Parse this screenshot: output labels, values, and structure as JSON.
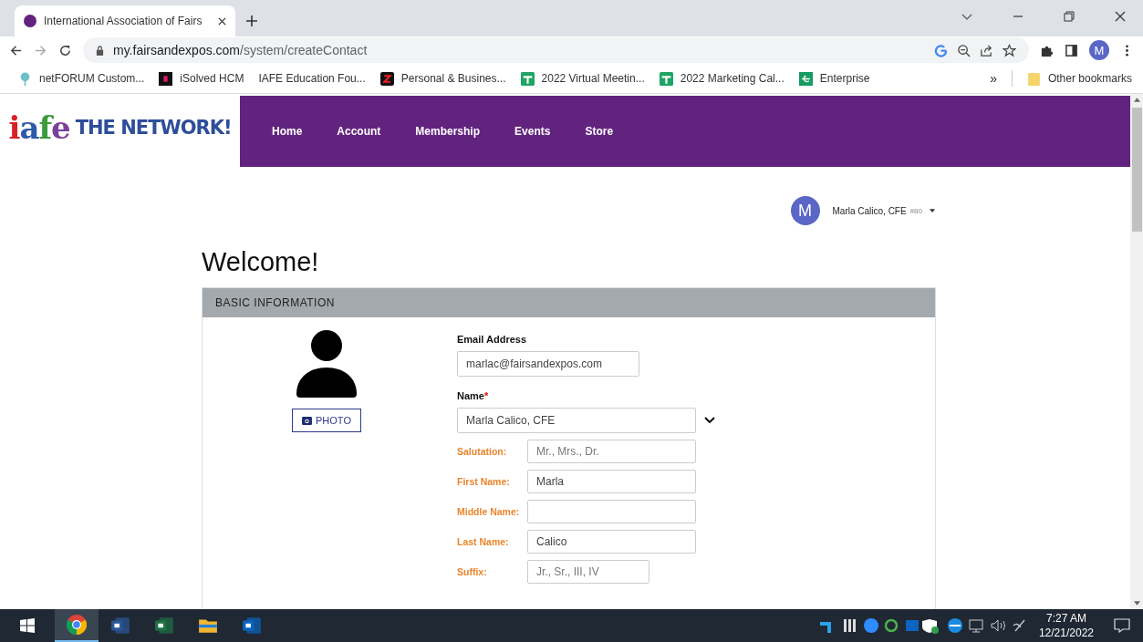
{
  "browser": {
    "tab": {
      "title": "International Association of Fairs",
      "selected": true
    },
    "address": {
      "domain": "my.fairsandexpos.com",
      "path": "/system/createContact"
    },
    "profile": "M",
    "bookmarks": [
      {
        "kind": "tree",
        "label": "netFORUM Custom..."
      },
      {
        "kind": "isolved",
        "label": "iSolved HCM"
      },
      {
        "kind": "none",
        "label": "IAFE Education Fou..."
      },
      {
        "kind": "zenefits",
        "label": "Personal & Busines..."
      },
      {
        "kind": "sheet",
        "label": "2022 Virtual Meetin..."
      },
      {
        "kind": "sheet",
        "label": "2022 Marketing Cal..."
      },
      {
        "kind": "enterprise",
        "label": "Enterprise"
      }
    ],
    "more": "»",
    "other_bookmarks": "Other bookmarks"
  },
  "site": {
    "logo": {
      "mark": "iafe",
      "tagline": "THE NETWORK!"
    },
    "nav": [
      "Home",
      "Account",
      "Membership",
      "Events",
      "Store"
    ],
    "user": {
      "initial": "M",
      "name": "Marla Calico, CFE",
      "number": "#80"
    }
  },
  "heading": "Welcome!",
  "section": {
    "title": "BASIC INFORMATION",
    "photo_button": "PHOTO",
    "email": {
      "label": "Email Address",
      "value": "marlac@fairsandexpos.com"
    },
    "name": {
      "label": "Name",
      "required_mark": "*",
      "value": "Marla Calico, CFE",
      "expanded": false
    },
    "fields": [
      {
        "label": "Salutation:",
        "placeholder": "Mr., Mrs., Dr."
      },
      {
        "label": "First Name:",
        "value": "Marla"
      },
      {
        "label": "Middle Name:"
      },
      {
        "label": "Last Name:",
        "value": "Calico"
      },
      {
        "label": "Suffix:",
        "placeholder": "Jr., Sr., III, IV",
        "short": true
      }
    ]
  },
  "taskbar": {
    "apps": [
      {
        "kind": "chrome",
        "selected": true
      },
      {
        "kind": "word",
        "selected": false
      },
      {
        "kind": "excel",
        "selected": false
      },
      {
        "kind": "explorer",
        "selected": false
      },
      {
        "kind": "outlook",
        "selected": false
      }
    ],
    "time": "7:27 AM",
    "date": "12/21/2022"
  }
}
